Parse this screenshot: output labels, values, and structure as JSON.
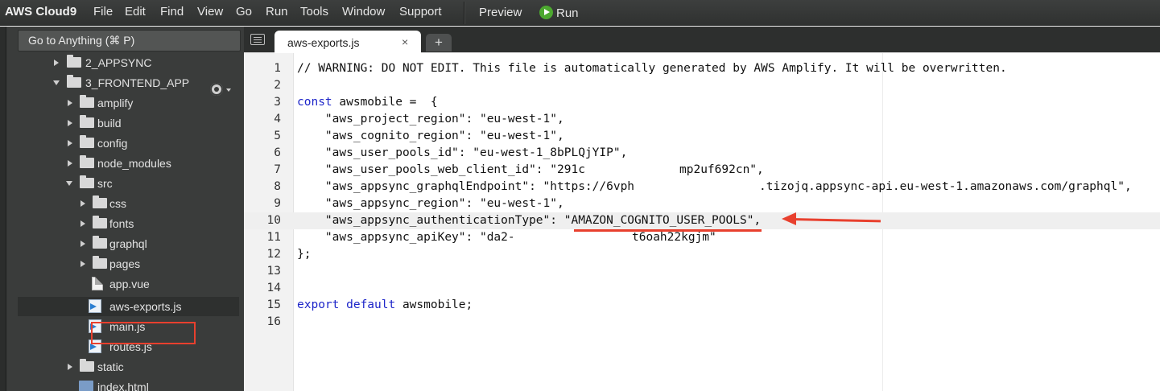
{
  "menubar": {
    "brand": "AWS Cloud9",
    "items": [
      "File",
      "Edit",
      "Find",
      "View",
      "Go",
      "Run",
      "Tools",
      "Window",
      "Support"
    ],
    "preview": "Preview",
    "run": "Run"
  },
  "sidebar": {
    "goto_label": "Go to Anything (⌘ P)",
    "tree": [
      {
        "label": "2_APPSYNC",
        "type": "folder",
        "expanded": false
      },
      {
        "label": "3_FRONTEND_APP",
        "type": "folder",
        "expanded": true
      },
      {
        "label": "amplify",
        "type": "folder",
        "expanded": false
      },
      {
        "label": "build",
        "type": "folder",
        "expanded": false
      },
      {
        "label": "config",
        "type": "folder",
        "expanded": false
      },
      {
        "label": "node_modules",
        "type": "folder",
        "expanded": false
      },
      {
        "label": "src",
        "type": "folder",
        "expanded": true
      },
      {
        "label": "css",
        "type": "folder",
        "expanded": false
      },
      {
        "label": "fonts",
        "type": "folder",
        "expanded": false
      },
      {
        "label": "graphql",
        "type": "folder",
        "expanded": false
      },
      {
        "label": "pages",
        "type": "folder",
        "expanded": false
      },
      {
        "label": "app.vue",
        "type": "file"
      },
      {
        "label": "aws-exports.js",
        "type": "js",
        "selected": true
      },
      {
        "label": "main.js",
        "type": "js"
      },
      {
        "label": "routes.js",
        "type": "js"
      },
      {
        "label": "static",
        "type": "folder",
        "expanded": false
      },
      {
        "label": "index.html",
        "type": "html"
      }
    ]
  },
  "tabs": {
    "active_tab": "aws-exports.js",
    "close": "×",
    "new_tab": "+"
  },
  "editor": {
    "line_numbers": [
      "1",
      "2",
      "3",
      "4",
      "5",
      "6",
      "7",
      "8",
      "9",
      "10",
      "11",
      "12",
      "13",
      "14",
      "15",
      "16"
    ],
    "line1": "// WARNING: DO NOT EDIT. This file is automatically generated by AWS Amplify. It will be overwritten.",
    "line3_kw": "const",
    "line3_rest": " awsmobile =  {",
    "line4": "    \"aws_project_region\": \"eu-west-1\",",
    "line5": "    \"aws_cognito_region\": \"eu-west-1\",",
    "line6": "    \"aws_user_pools_id\": \"eu-west-1_8bPLQjYIP\",",
    "line7_a": "    \"aws_user_pools_web_client_id\": \"291c",
    "line7_b": "mp2uf692cn\",",
    "line8_a": "    \"aws_appsync_graphqlEndpoint\": \"https://6vph",
    "line8_b": ".tizojq.appsync-api.eu-west-1.amazonaws.com/graphql\",",
    "line9": "    \"aws_appsync_region\": \"eu-west-1\",",
    "line10": "    \"aws_appsync_authenticationType\": \"AMAZON_COGNITO_USER_POOLS\",",
    "line11_a": "    \"aws_appsync_apiKey\": \"da2-",
    "line11_b": "t6oah22kgjm\"",
    "line12": "};",
    "line15_kw": "export default",
    "line15_rest": " awsmobile;"
  }
}
